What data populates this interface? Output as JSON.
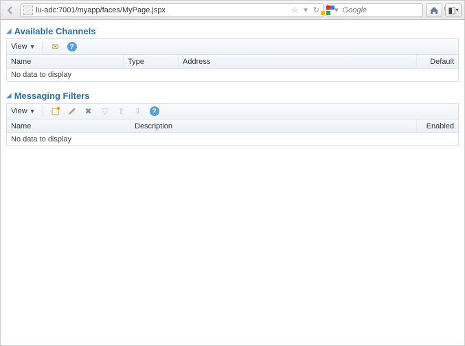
{
  "browser": {
    "url": "lu-adc:7001/myapp/faces/MyPage.jspx",
    "search_placeholder": "Google"
  },
  "panel1": {
    "title": "Available Channels",
    "view_label": "View",
    "columns": {
      "name": "Name",
      "type": "Type",
      "address": "Address",
      "default": "Default"
    },
    "empty_text": "No data to display"
  },
  "panel2": {
    "title": "Messaging Filters",
    "view_label": "View",
    "columns": {
      "name": "Name",
      "description": "Description",
      "enabled": "Enabled"
    },
    "empty_text": "No data to display"
  }
}
